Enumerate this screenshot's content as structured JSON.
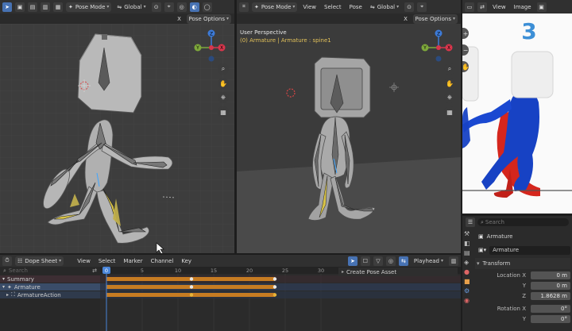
{
  "left_viewport": {
    "header": {
      "mode": "Pose Mode",
      "orientation": "Global",
      "pose_options": "Pose Options",
      "x_label": "X"
    }
  },
  "mid_viewport": {
    "header": {
      "mode": "Pose Mode",
      "menus": [
        "View",
        "Select",
        "Pose"
      ],
      "orientation": "Global",
      "pose_options": "Pose Options",
      "x_label": "X"
    },
    "overlay": {
      "perspective": "User Perspective",
      "context": "(0) Armature | Armature : spine1"
    }
  },
  "right_viewport": {
    "header": {
      "menus": [
        "View",
        "Image"
      ]
    },
    "frame_number": "3"
  },
  "gizmo": {
    "x": "X",
    "y": "Y",
    "z": "Z"
  },
  "dope_sheet": {
    "editor": "Dope Sheet",
    "menus": [
      "View",
      "Select",
      "Marker",
      "Channel",
      "Key"
    ],
    "playhead": "Playhead",
    "search_placeholder": "Search",
    "frame_ticks": [
      "0",
      "5",
      "10",
      "15",
      "20",
      "25",
      "30"
    ],
    "current_frame": "0",
    "create_pose_asset": "Create Pose Asset",
    "channels": [
      "Summary",
      "Armature",
      "ArmatureAction"
    ]
  },
  "properties": {
    "search_placeholder": "Search",
    "object_name": "Armature",
    "data_name": "Armature",
    "section": "Transform",
    "fields": [
      {
        "label": "Location X",
        "value": "0 m"
      },
      {
        "label": "Y",
        "value": "0 m"
      },
      {
        "label": "Z",
        "value": "1.8628 m"
      },
      {
        "label": "Rotation X",
        "value": "0°"
      },
      {
        "label": "Y",
        "value": "0°"
      }
    ]
  },
  "colors": {
    "viewport_bg": "#3d3d3d",
    "grid_line": "#4a4a4a",
    "floor": "#4a4a4a",
    "keyframe_bar": "#c67c22",
    "header_bg": "#303030",
    "accent": "#4772b3",
    "frame_number": "#3d8fd6"
  }
}
